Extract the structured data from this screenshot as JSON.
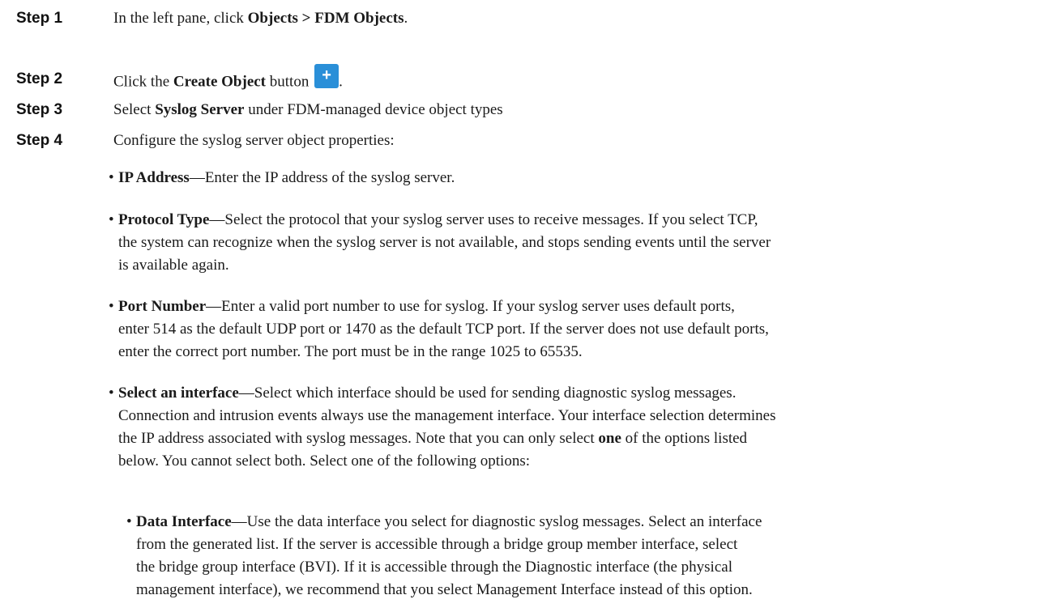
{
  "steps": [
    {
      "label": "Step 1",
      "pre": "In the left pane, click ",
      "bold": "Objects > FDM Objects",
      "post": "."
    },
    {
      "label": "Step 2",
      "pre": "Click the ",
      "bold": "Create Object",
      "post": " button",
      "end": "."
    },
    {
      "label": "Step 3",
      "pre": "Select ",
      "bold": "Syslog Server",
      "post": " under FDM-managed device object types"
    },
    {
      "label": "Step 4",
      "text": "Configure the syslog server object properties:"
    }
  ],
  "create_button_icon": "plus-icon",
  "bullets": [
    {
      "term": "IP Address",
      "text": "—Enter the IP address of the syslog server."
    },
    {
      "term": "Protocol Type",
      "line1": "—Select the protocol that your syslog server uses to receive messages. If you select TCP,",
      "line2": "the system can recognize when the syslog server is not available, and stops sending events until the server",
      "line3": "is available again."
    },
    {
      "term": "Port Number",
      "line1": "—Enter a valid port number to use for syslog. If your syslog server uses default ports,",
      "line2": "enter 514 as the default UDP port or 1470 as the default TCP port. If the server does not use default ports,",
      "line3": "enter the correct port number. The port must be in the range 1025 to 65535."
    },
    {
      "term": "Select an interface",
      "line1": "—Select which interface should be used for sending diagnostic syslog messages.",
      "line2": "Connection and intrusion events always use the management interface. Your interface selection determines",
      "line3": "the IP address associated with syslog messages. Note that you can only select ",
      "line3_bold": "one",
      "line3_post": " of the options listed",
      "line4": "below. You cannot select both. Select one of the following options:"
    }
  ],
  "sub_bullets": [
    {
      "term": "Data Interface",
      "line1": "—Use the data interface you select for diagnostic syslog messages. Select an interface",
      "line2": "from the generated list. If the server is accessible through a bridge group member interface, select",
      "line3": "the bridge group interface (BVI). If it is accessible through the Diagnostic interface (the physical",
      "line4": "management interface), we recommend that you select Management Interface instead of this option."
    }
  ],
  "bullet_glyph": "•"
}
